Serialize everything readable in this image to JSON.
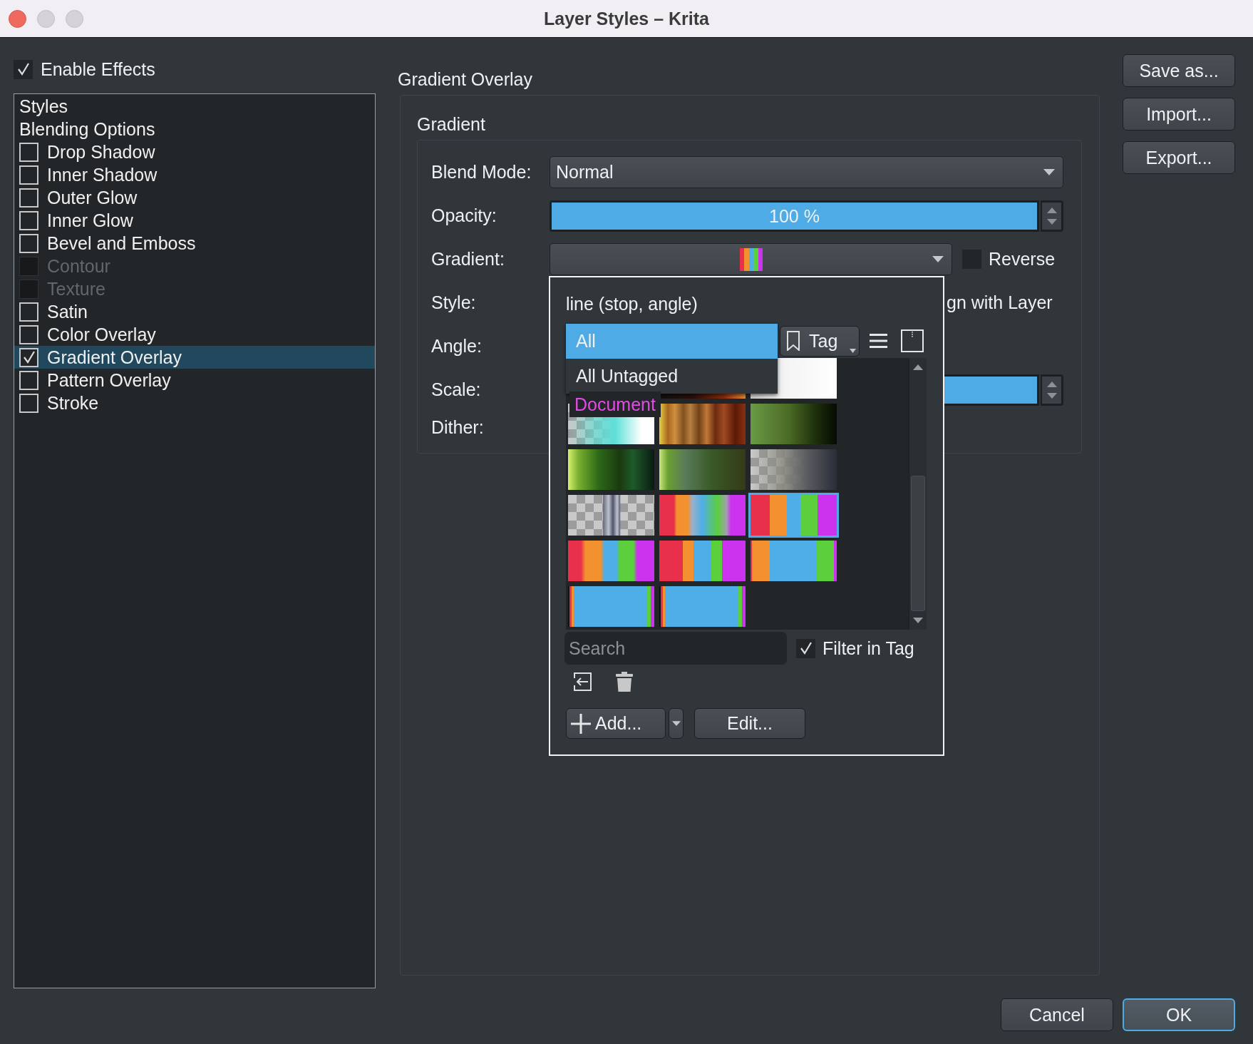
{
  "window": {
    "title": "Layer Styles – Krita"
  },
  "enable_effects": {
    "label": "Enable Effects",
    "checked": true
  },
  "effects_list": [
    {
      "kind": "header",
      "label": "Styles",
      "selected": false
    },
    {
      "kind": "header",
      "label": "Blending Options",
      "selected": false
    },
    {
      "kind": "effect",
      "label": "Drop Shadow",
      "checked": false,
      "disabled": false,
      "selected": false
    },
    {
      "kind": "effect",
      "label": "Inner Shadow",
      "checked": false,
      "disabled": false,
      "selected": false
    },
    {
      "kind": "effect",
      "label": "Outer Glow",
      "checked": false,
      "disabled": false,
      "selected": false
    },
    {
      "kind": "effect",
      "label": "Inner Glow",
      "checked": false,
      "disabled": false,
      "selected": false
    },
    {
      "kind": "effect",
      "label": "Bevel and Emboss",
      "checked": false,
      "disabled": false,
      "selected": false
    },
    {
      "kind": "effect",
      "label": "Contour",
      "checked": false,
      "disabled": true,
      "selected": false
    },
    {
      "kind": "effect",
      "label": "Texture",
      "checked": false,
      "disabled": true,
      "selected": false
    },
    {
      "kind": "effect",
      "label": "Satin",
      "checked": false,
      "disabled": false,
      "selected": false
    },
    {
      "kind": "effect",
      "label": "Color Overlay",
      "checked": false,
      "disabled": false,
      "selected": false
    },
    {
      "kind": "effect",
      "label": "Gradient Overlay",
      "checked": true,
      "disabled": false,
      "selected": true
    },
    {
      "kind": "effect",
      "label": "Pattern Overlay",
      "checked": false,
      "disabled": false,
      "selected": false
    },
    {
      "kind": "effect",
      "label": "Stroke",
      "checked": false,
      "disabled": false,
      "selected": false
    }
  ],
  "panel": {
    "title": "Gradient Overlay",
    "group_title": "Gradient",
    "rows": [
      {
        "kind": "combo",
        "label": "Blend Mode:",
        "value": "Normal"
      },
      {
        "kind": "slider",
        "label": "Opacity:",
        "level": 1,
        "reading": "100 %"
      },
      {
        "kind": "gradient",
        "label": "Gradient:",
        "reverse": {
          "label": "Reverse",
          "checked": false
        }
      },
      {
        "kind": "trailing_text",
        "label": "Style:",
        "text": "gn with Layer"
      },
      {
        "kind": "blank",
        "label": "Angle:"
      },
      {
        "kind": "cropped_slider",
        "label": "Scale:",
        "level": 1
      },
      {
        "kind": "blank",
        "label": "Dither:"
      }
    ]
  },
  "side_buttons": [
    "Save as...",
    "Import...",
    "Export..."
  ],
  "gradient_picker": {
    "preset_name": "line (stop, angle)",
    "tag_options": [
      {
        "label": "All",
        "selected": true
      },
      {
        "label": "All Untagged",
        "selected": false
      }
    ],
    "tag_button": "Tag",
    "group_label": "Document",
    "presets": [
      {
        "selected": false
      },
      {
        "selected": false
      },
      {
        "selected": false
      },
      {
        "selected": false
      },
      {
        "selected": false
      },
      {
        "selected": false
      },
      {
        "selected": false
      },
      {
        "selected": false
      },
      {
        "selected": false
      },
      {
        "selected": false
      },
      {
        "selected": true
      },
      {
        "selected": false
      },
      {
        "selected": false
      },
      {
        "selected": false
      },
      {
        "selected": false
      },
      {
        "selected": false
      }
    ],
    "search": {
      "placeholder": "Search"
    },
    "filter_in_tag": {
      "label": "Filter in Tag",
      "checked": true
    },
    "add_button": "Add...",
    "edit_button": "Edit..."
  },
  "dialog_buttons": [
    {
      "label": "Cancel",
      "focused": false
    },
    {
      "label": "OK",
      "focused": true
    }
  ]
}
